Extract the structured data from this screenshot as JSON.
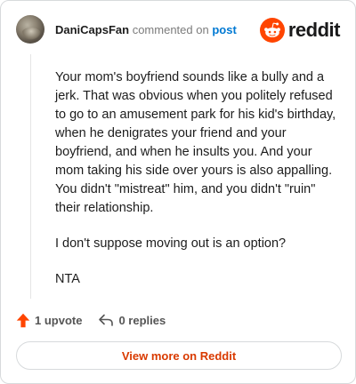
{
  "comment": {
    "author": "DaniCapsFan",
    "action_text": "commented on",
    "post_link": "post",
    "paragraphs": [
      "Your mom's boyfriend sounds like a bully and a jerk. That was obvious when you politely refused to go to an amusement park for his kid's birthday, when he denigrates your friend and your boyfriend, and when he insults you. And your mom taking his side over yours is also appalling. You didn't \"mistreat\" him, and you didn't \"ruin\" their relationship.",
      "I don't suppose moving out is an option?",
      "NTA"
    ]
  },
  "brand": {
    "wordmark": "reddit",
    "icon": "reddit-alien-logo",
    "color": "#ff4500"
  },
  "actions": {
    "upvote_label": "1 upvote",
    "upvote_icon": "upvote-arrow-icon",
    "upvote_color": "#ff4500",
    "reply_label": "0 replies",
    "reply_icon": "reply-arrow-icon"
  },
  "footer": {
    "view_more_label": "View more on Reddit",
    "link_color": "#d93a00"
  }
}
